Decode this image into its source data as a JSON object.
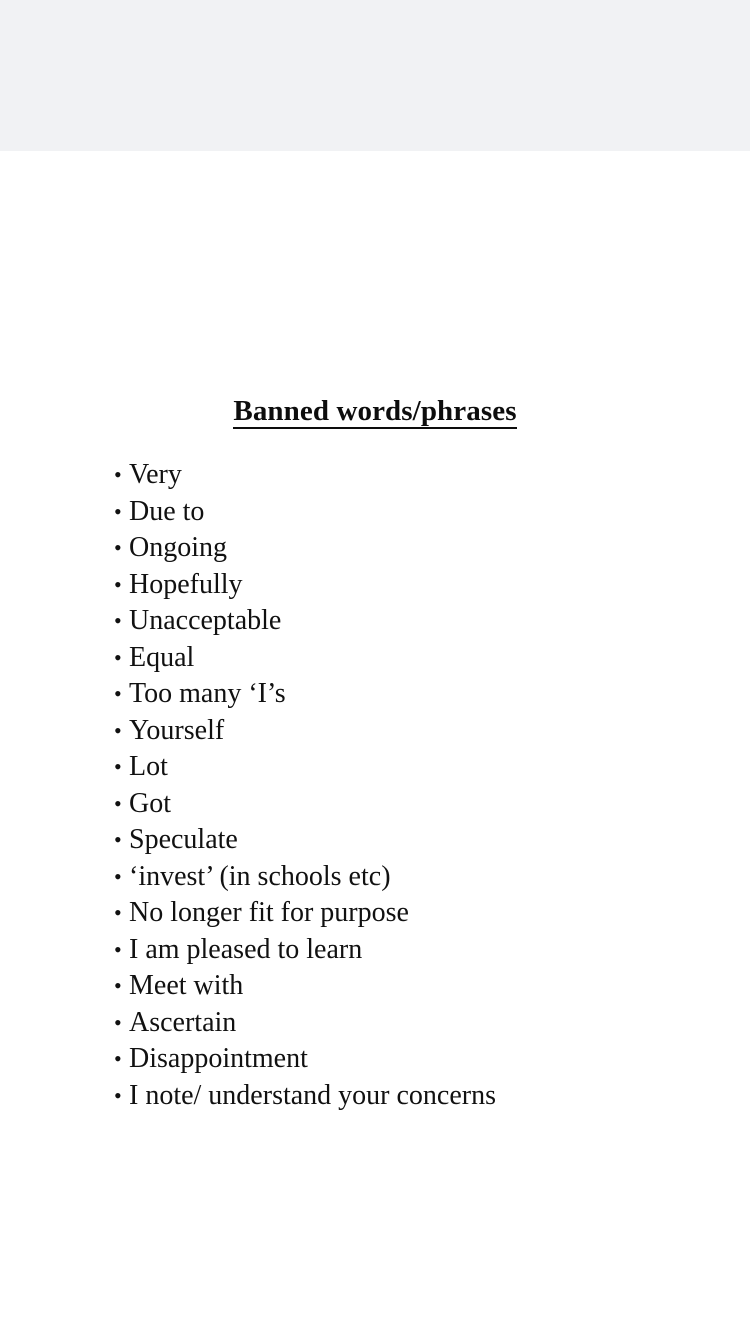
{
  "screen": {
    "top_band_color": "#f1f2f4",
    "page_background": "#ffffff",
    "text_color": "#111111"
  },
  "document": {
    "title": "Banned words/phrases",
    "bullet_glyph": "•",
    "items": [
      {
        "text": "Very"
      },
      {
        "text": "Due to"
      },
      {
        "text": "Ongoing"
      },
      {
        "text": "Hopefully"
      },
      {
        "text": "Unacceptable"
      },
      {
        "text": "Equal"
      },
      {
        "text": "Too many ‘I’s"
      },
      {
        "text": "Yourself"
      },
      {
        "text": "Lot"
      },
      {
        "text": "Got"
      },
      {
        "text": "Speculate"
      },
      {
        "text": "‘invest’ (in schools etc)"
      },
      {
        "text": "No longer fit for purpose"
      },
      {
        "text": "I am pleased to learn"
      },
      {
        "text": "Meet with"
      },
      {
        "text": "Ascertain"
      },
      {
        "text": "Disappointment"
      },
      {
        "text": "I note/ understand your concerns"
      }
    ]
  }
}
